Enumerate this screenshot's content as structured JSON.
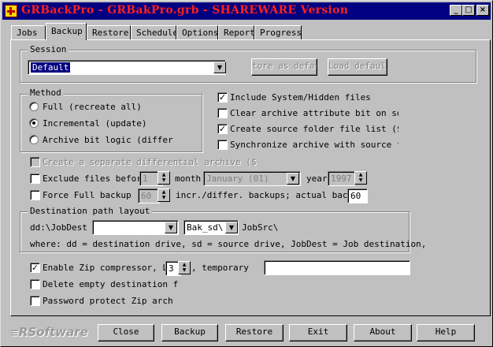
{
  "window": {
    "title": "GRBackPro - GRBakPro.grb - SHAREWARE Version",
    "controls": [
      "_",
      "□",
      "×"
    ]
  },
  "tabs": [
    "Jobs",
    "Backup",
    "Restore",
    "Schedule",
    "Options",
    "Report",
    "Progress"
  ],
  "active_tab": "Backup",
  "session": {
    "group_label": "Session",
    "selected": "Default",
    "store_button": "tore as defaul",
    "load_button": "Load default"
  },
  "method": {
    "group_label": "Method",
    "options": [
      {
        "label": "Full (recreate all)",
        "checked": false
      },
      {
        "label": "Incremental (update)",
        "checked": true
      },
      {
        "label": "Archive bit logic (differ",
        "checked": false
      }
    ]
  },
  "options": [
    {
      "label": "Include System/Hidden files",
      "checked": true
    },
    {
      "label": "Clear archive attribute bit on sourc",
      "checked": false
    },
    {
      "label": "Create source folder file list ($bac",
      "checked": true
    },
    {
      "label": "Synchronize archive with source fol",
      "checked": false
    }
  ],
  "differential": {
    "label": "Create a separate differential archive ($",
    "checked": false
  },
  "exclude": {
    "label": "Exclude files before",
    "checked": false,
    "value": "1",
    "month_label": "month",
    "month_value": "January (01)",
    "year_label": "year",
    "year_value": "1997"
  },
  "force_full": {
    "label": "Force Full  backup",
    "checked": false,
    "value": "60",
    "suffix": "incr./differ. backups; actual backup",
    "actual": "60"
  },
  "destination": {
    "group_label": "Destination path layout",
    "prefix": "dd:\\JobDest",
    "combo1_value": "",
    "combo2_value": "Bak_sd\\",
    "suffix": "JobSrc\\",
    "legend": "where: dd = destination drive, sd = source drive, JobDest = Job destination,"
  },
  "zip": {
    "label": "Enable Zip compressor, Le",
    "checked": true,
    "level": "3",
    "temporary_label": ", temporary",
    "temporary_value": ""
  },
  "delete_empty": {
    "label": "Delete empty destination f",
    "checked": false
  },
  "password_zip": {
    "label": "Password protect Zip arch",
    "checked": false
  },
  "logo_text": "RSoftware",
  "buttons": [
    "Close",
    "Backup",
    "Restore",
    "Exit",
    "About",
    "Help"
  ]
}
